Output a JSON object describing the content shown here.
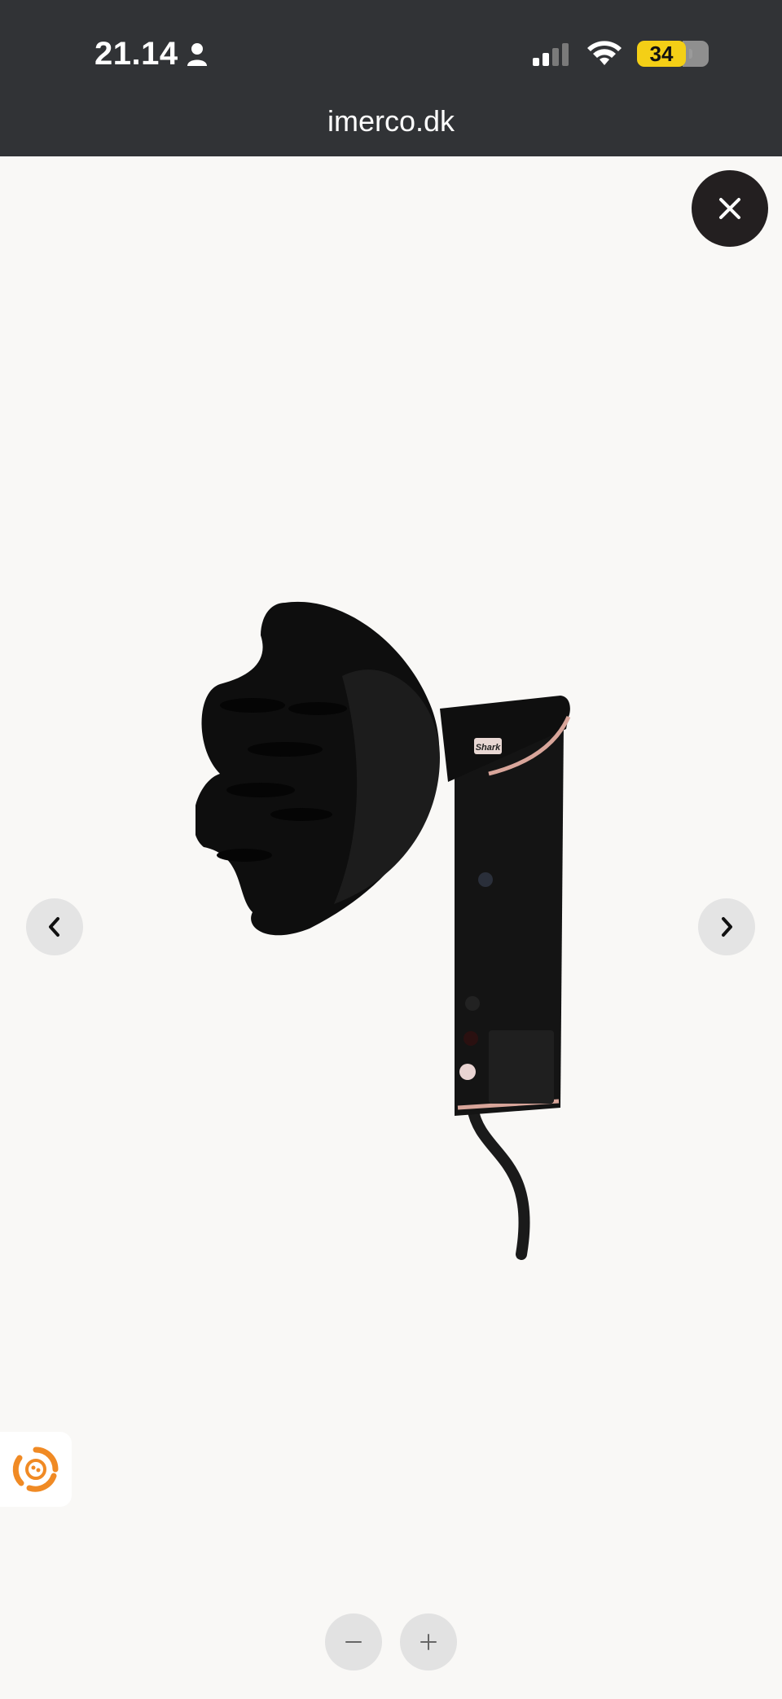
{
  "statusbar": {
    "time": "21.14",
    "battery": "34",
    "icons": [
      "person-icon",
      "signal-icon",
      "wifi-icon",
      "battery-icon"
    ]
  },
  "browser": {
    "url": "imerco.dk"
  },
  "gallery": {
    "close_icon": "close-icon",
    "prev_icon": "chevron-left-icon",
    "next_icon": "chevron-right-icon",
    "product_brand_label": "Shark",
    "zoom_out_icon": "minus-icon",
    "zoom_in_icon": "plus-icon"
  },
  "widget": {
    "icon": "recycle-widget-icon"
  },
  "colors": {
    "statusbar_bg": "#313336",
    "page_bg": "#f9f8f6",
    "close_bg": "#231f20",
    "battery_fill": "#f4cf16",
    "accent_orange": "#f08a24"
  }
}
